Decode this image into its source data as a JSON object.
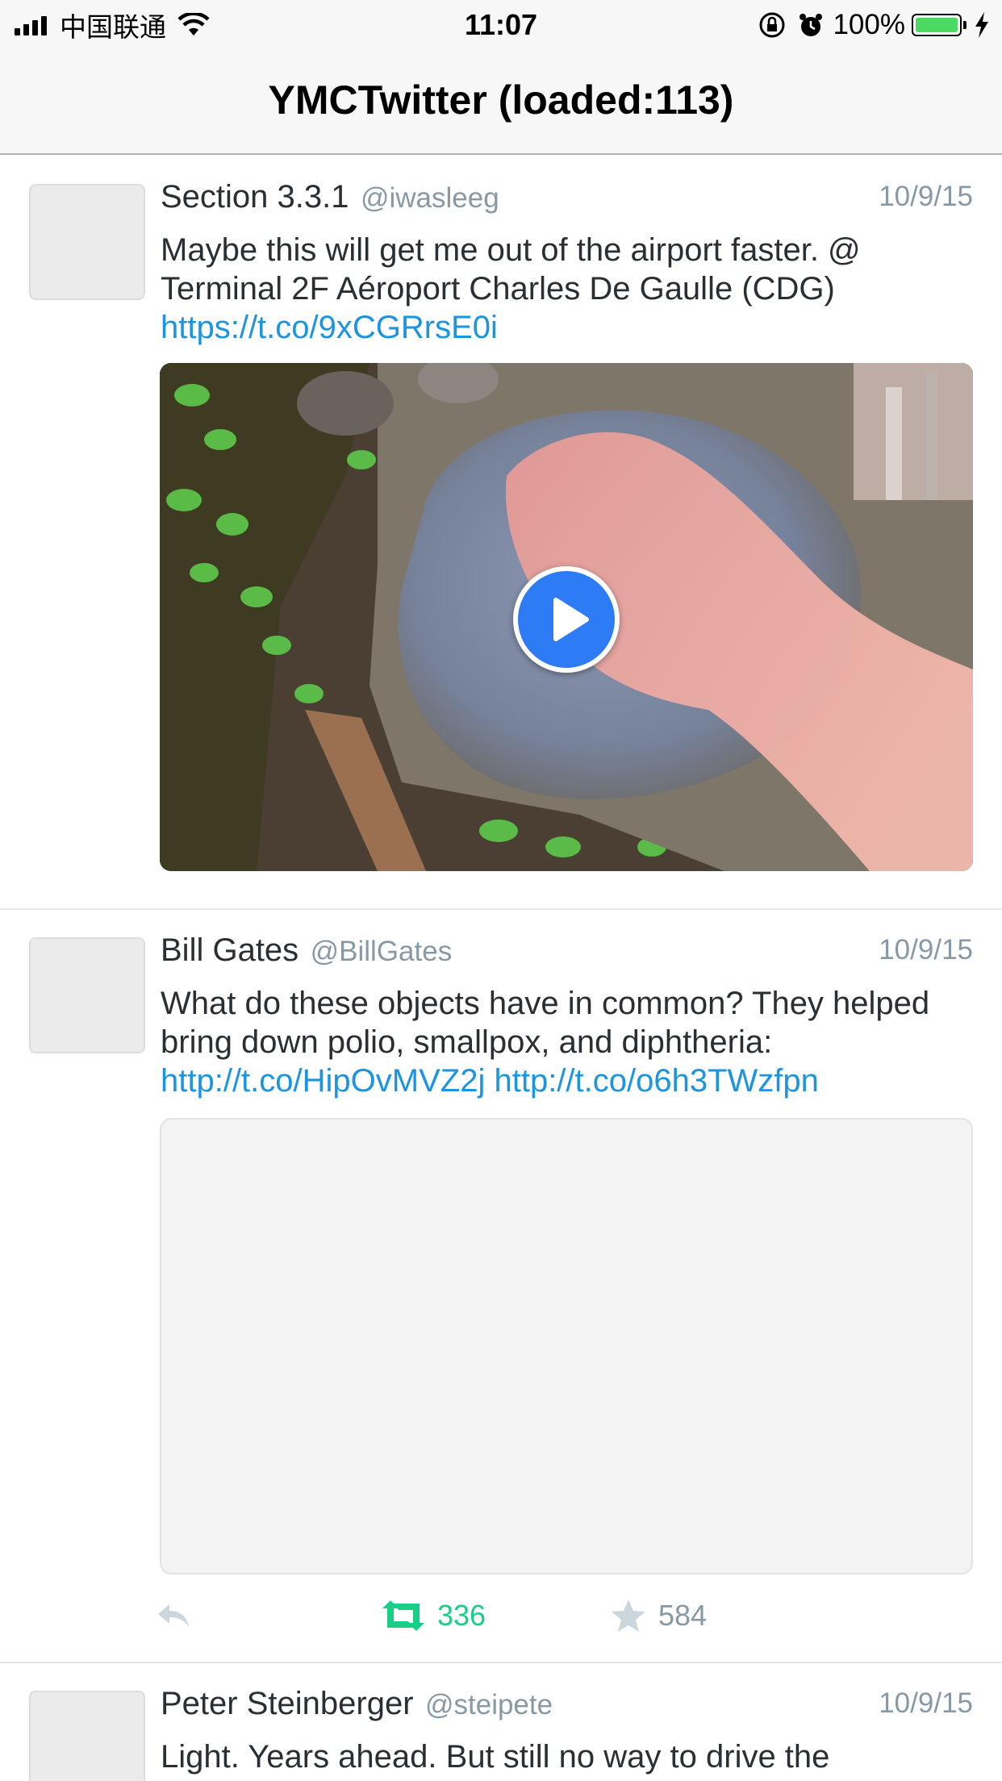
{
  "status_bar": {
    "carrier": "中国联通",
    "time": "11:07",
    "battery": "100%",
    "icons": [
      "signal-icon",
      "wifi-icon",
      "orientation-lock-icon",
      "alarm-icon",
      "battery-icon",
      "charging-icon"
    ],
    "battery_color": "#4cd964"
  },
  "nav": {
    "title": "YMCTwitter (loaded:113)"
  },
  "colors": {
    "link": "#1b95e0",
    "retweet_active": "#19cf86",
    "muted": "#8899a6",
    "play": "#2d7cf6"
  },
  "tweets": [
    {
      "name": "Section 3.3.1",
      "handle": "@iwasleeg",
      "date": "10/9/15",
      "text": "Maybe this will get me out of the airport faster. @ Terminal 2F Aéroport Charles De Gaulle (CDG)",
      "links": [
        "https://t.co/9xCGRrsE0i"
      ],
      "media": "video"
    },
    {
      "name": "Bill Gates",
      "handle": "@BillGates",
      "date": "10/9/15",
      "text": "What do these objects have in common? They helped bring down polio, smallpox, and diphtheria:",
      "links": [
        "http://t.co/HipOvMVZ2j",
        "http://t.co/o6h3TWzfpn"
      ],
      "media": "image-placeholder",
      "retweets": "336",
      "likes": "584"
    },
    {
      "name": "Peter Steinberger",
      "handle": "@steipete",
      "date": "10/9/15",
      "text": "Light. Years ahead. But still no way to drive the"
    }
  ]
}
